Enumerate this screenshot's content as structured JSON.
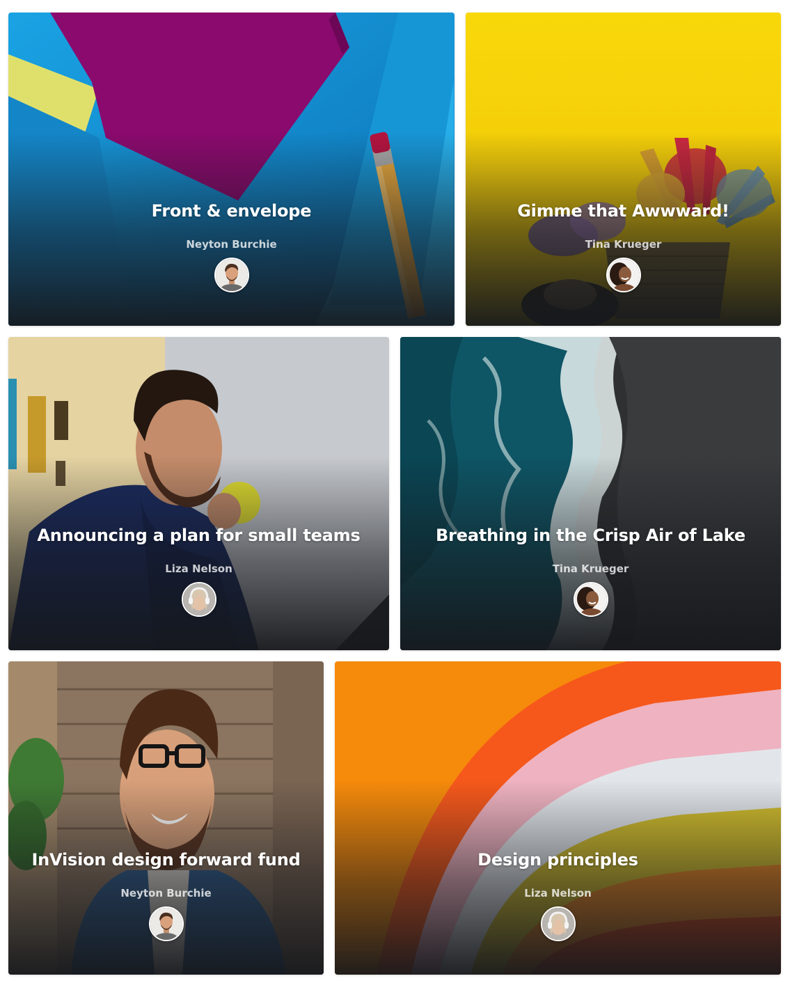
{
  "cards": [
    {
      "title": "Front & envelope",
      "author": "Neyton Burchie",
      "avatar_icon": "man-portrait-avatar",
      "colors": {
        "primary": "#1b9ad9",
        "accent": "#8c0a6e",
        "highlight": "#e3e16b"
      }
    },
    {
      "title": "Gimme that Awwward!",
      "author": "Tina Krueger",
      "avatar_icon": "woman-portrait-avatar",
      "colors": {
        "primary": "#f5d10a",
        "accent": "#c4203f",
        "highlight": "#6a8ea6"
      }
    },
    {
      "title": "Announcing a plan for small teams",
      "author": "Liza Nelson",
      "avatar_icon": "woman-headphones-avatar",
      "colors": {
        "primary": "#cfd3d8",
        "accent": "#1a2b5a",
        "highlight": "#e8e032"
      }
    },
    {
      "title": "Breathing in the Crisp Air of Lake",
      "author": "Tina Krueger",
      "avatar_icon": "woman-portrait-avatar",
      "colors": {
        "primary": "#0f5a68",
        "accent": "#3a3b3d",
        "highlight": "#e9f3f2"
      }
    },
    {
      "title": "InVision design forward fund",
      "author": "Neyton Burchie",
      "avatar_icon": "man-portrait-avatar",
      "colors": {
        "primary": "#8c7660",
        "accent": "#2f5c8e",
        "highlight": "#3a7a3a"
      }
    },
    {
      "title": "Design principles",
      "author": "Liza Nelson",
      "avatar_icon": "woman-headphones-avatar",
      "colors": {
        "primary": "#fb8c0c",
        "accent": "#f0bcc8",
        "highlight": "#d6c430"
      }
    }
  ]
}
